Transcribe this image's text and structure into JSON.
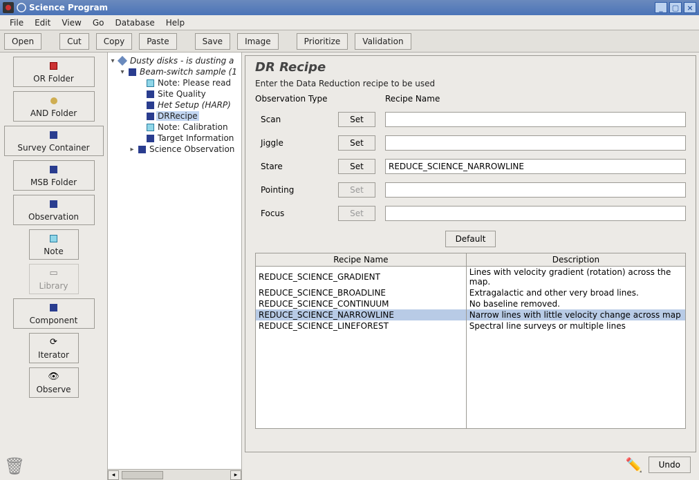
{
  "window": {
    "title": "Science Program"
  },
  "menubar": {
    "items": [
      "File",
      "Edit",
      "View",
      "Go",
      "Database",
      "Help"
    ]
  },
  "toolbar": {
    "open": "Open",
    "cut": "Cut",
    "copy": "Copy",
    "paste": "Paste",
    "save": "Save",
    "image": "Image",
    "prioritize": "Prioritize",
    "validation": "Validation"
  },
  "palette": {
    "or_folder": "OR Folder",
    "and_folder": "AND Folder",
    "survey_container": "Survey Container",
    "msb_folder": "MSB Folder",
    "observation": "Observation",
    "note": "Note",
    "library": "Library",
    "component": "Component",
    "iterator": "Iterator",
    "observe": "Observe"
  },
  "tree": {
    "root": "Dusty disks - is dusting a",
    "l1": "Beam-switch sample (1",
    "items": [
      {
        "label": "Note: Please read",
        "icon": "note"
      },
      {
        "label": "Site Quality",
        "icon": "blue"
      },
      {
        "label": "Het Setup (HARP)",
        "icon": "blue",
        "italic": true
      },
      {
        "label": "DRRecipe",
        "icon": "blue",
        "selected": true
      },
      {
        "label": "Note: Calibration",
        "icon": "note"
      },
      {
        "label": "Target Information",
        "icon": "blue"
      },
      {
        "label": "Science Observation",
        "icon": "blue"
      }
    ]
  },
  "editor": {
    "title": "DR Recipe",
    "subtitle": "Enter the Data Reduction recipe to be used",
    "col_obs": "Observation Type",
    "col_recipe": "Recipe Name",
    "rows": {
      "scan": {
        "label": "Scan",
        "set": "Set",
        "enabled": true,
        "value": ""
      },
      "jiggle": {
        "label": "Jiggle",
        "set": "Set",
        "enabled": true,
        "value": ""
      },
      "stare": {
        "label": "Stare",
        "set": "Set",
        "enabled": true,
        "value": "REDUCE_SCIENCE_NARROWLINE"
      },
      "pointing": {
        "label": "Pointing",
        "set": "Set",
        "enabled": false,
        "value": ""
      },
      "focus": {
        "label": "Focus",
        "set": "Set",
        "enabled": false,
        "value": ""
      }
    },
    "default_btn": "Default",
    "table": {
      "col_name": "Recipe Name",
      "col_desc": "Description",
      "rows": [
        {
          "name": "REDUCE_SCIENCE_GRADIENT",
          "desc": "Lines with velocity gradient (rotation) across the map."
        },
        {
          "name": "REDUCE_SCIENCE_BROADLINE",
          "desc": "Extragalactic and other very broad lines."
        },
        {
          "name": "REDUCE_SCIENCE_CONTINUUM",
          "desc": "No baseline removed."
        },
        {
          "name": "REDUCE_SCIENCE_NARROWLINE",
          "desc": "Narrow lines with little velocity change across map",
          "selected": true
        },
        {
          "name": "REDUCE_SCIENCE_LINEFOREST",
          "desc": "Spectral line surveys or multiple lines"
        }
      ]
    }
  },
  "footer": {
    "undo": "Undo"
  }
}
